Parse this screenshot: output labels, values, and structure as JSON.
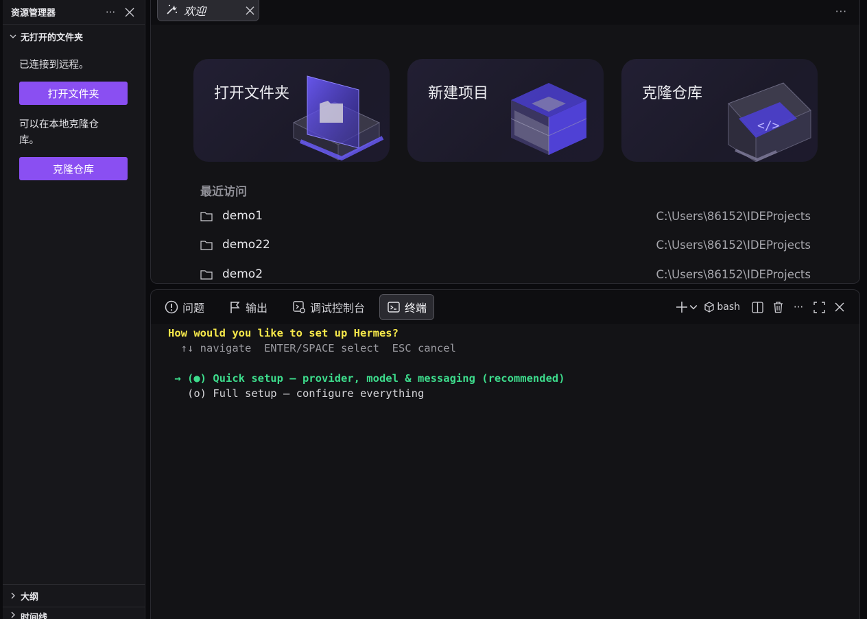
{
  "sidebar": {
    "title": "资源管理器",
    "more_icon": "ellipsis-icon",
    "close_icon": "close-icon",
    "section_title": "无打开的文件夹",
    "remote_text": "已连接到远程。",
    "open_folder_btn": "打开文件夹",
    "clone_text": "可以在本地克隆仓库。",
    "clone_btn": "克隆仓库",
    "outline": "大纲",
    "timeline": "时间线"
  },
  "editor": {
    "tab_label": "欢迎",
    "cards": [
      {
        "title": "打开文件夹"
      },
      {
        "title": "新建项目"
      },
      {
        "title": "克隆仓库"
      }
    ],
    "recent_title": "最近访问",
    "recent": [
      {
        "name": "demo1",
        "path": "C:\\Users\\86152\\IDEProjects"
      },
      {
        "name": "demo22",
        "path": "C:\\Users\\86152\\IDEProjects"
      },
      {
        "name": "demo2",
        "path": "C:\\Users\\86152\\IDEProjects"
      }
    ]
  },
  "panel": {
    "tabs": [
      {
        "label": "问题",
        "icon": "alert-circle-icon"
      },
      {
        "label": "输出",
        "icon": "flag-icon"
      },
      {
        "label": "调试控制台",
        "icon": "debug-console-icon"
      },
      {
        "label": "终端",
        "icon": "terminal-icon",
        "active": true
      }
    ],
    "shell_label": "bash",
    "terminal": {
      "line1": "How would you like to set up Hermes?",
      "line2": "  ↑↓ navigate  ENTER/SPACE select  ESC cancel",
      "line3": " → (●) Quick setup — provider, model & messaging (recommended)",
      "line4": "   (o) Full setup — configure everything"
    }
  },
  "colors": {
    "accent": "#8a4ff2",
    "terminal_yellow": "#f6e84a",
    "terminal_green": "#3ddc8c"
  }
}
